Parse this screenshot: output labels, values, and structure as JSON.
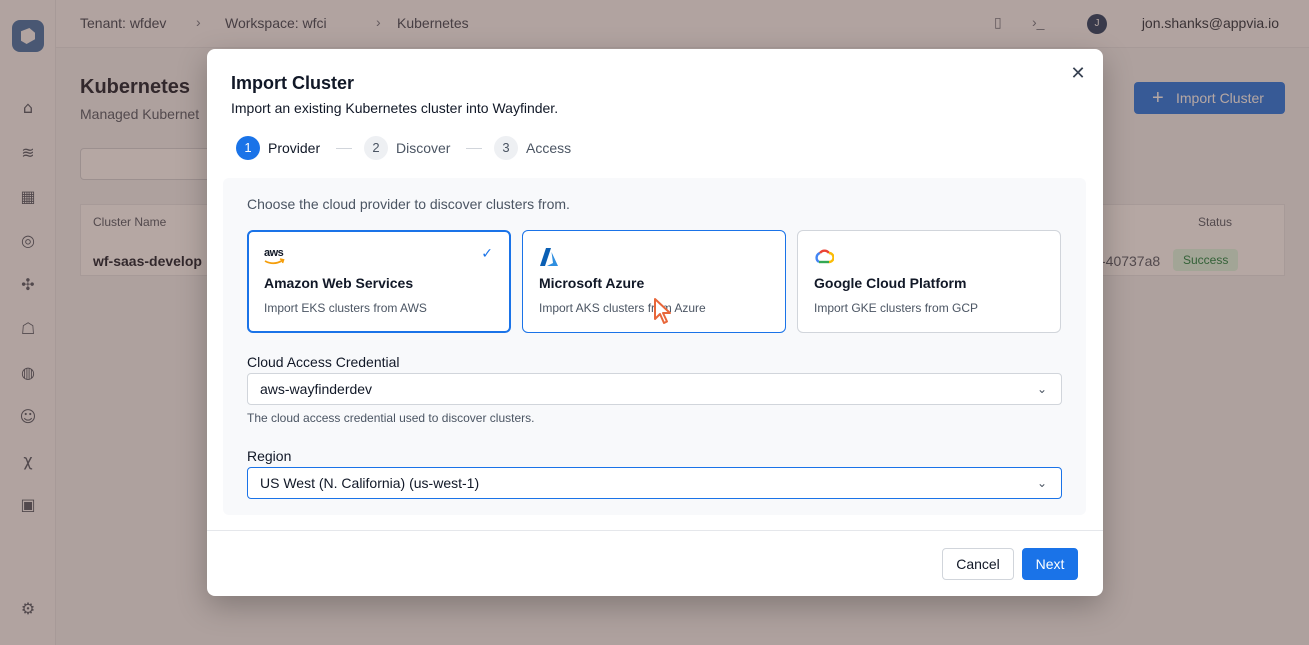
{
  "topbar": {
    "tenant": "Tenant: wfdev",
    "workspace": "Workspace: wfci",
    "section": "Kubernetes",
    "user_initial": "J",
    "user_email": "jon.shanks@appvia.io"
  },
  "page": {
    "title": "Kubernetes",
    "subtitle": "Managed Kubernet",
    "import_button": "Import Cluster"
  },
  "table": {
    "col_cluster": "Cluster Name",
    "col_status": "Status",
    "row_name": "wf-saas-develop",
    "row_id": "-40737a8",
    "row_status": "Success"
  },
  "modal": {
    "title": "Import Cluster",
    "subtitle": "Import an existing Kubernetes cluster into Wayfinder.",
    "steps": [
      {
        "num": "1",
        "label": "Provider"
      },
      {
        "num": "2",
        "label": "Discover"
      },
      {
        "num": "3",
        "label": "Access"
      }
    ],
    "intro": "Choose the cloud provider to discover clusters from.",
    "providers": [
      {
        "name": "Amazon Web Services",
        "desc": "Import EKS clusters from AWS",
        "logo_text": "aws"
      },
      {
        "name": "Microsoft Azure",
        "desc": "Import AKS clusters from Azure"
      },
      {
        "name": "Google Cloud Platform",
        "desc": "Import GKE clusters from GCP"
      }
    ],
    "credential": {
      "label": "Cloud Access Credential",
      "value": "aws-wayfinderdev",
      "help": "The cloud access credential used to discover clusters."
    },
    "region": {
      "label": "Region",
      "value": "US West (N. California) (us-west-1)"
    },
    "cancel": "Cancel",
    "next": "Next"
  },
  "colors": {
    "accent": "#1a73e8",
    "overlay": "#5a3c32"
  }
}
